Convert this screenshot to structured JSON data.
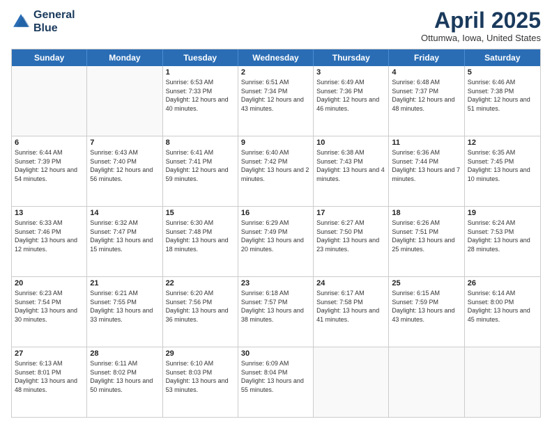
{
  "header": {
    "logo_line1": "General",
    "logo_line2": "Blue",
    "month_title": "April 2025",
    "location": "Ottumwa, Iowa, United States"
  },
  "days_of_week": [
    "Sunday",
    "Monday",
    "Tuesday",
    "Wednesday",
    "Thursday",
    "Friday",
    "Saturday"
  ],
  "weeks": [
    [
      {
        "day": "",
        "empty": true
      },
      {
        "day": "",
        "empty": true
      },
      {
        "day": "1",
        "sunrise": "6:53 AM",
        "sunset": "7:33 PM",
        "daylight": "12 hours and 40 minutes."
      },
      {
        "day": "2",
        "sunrise": "6:51 AM",
        "sunset": "7:34 PM",
        "daylight": "12 hours and 43 minutes."
      },
      {
        "day": "3",
        "sunrise": "6:49 AM",
        "sunset": "7:36 PM",
        "daylight": "12 hours and 46 minutes."
      },
      {
        "day": "4",
        "sunrise": "6:48 AM",
        "sunset": "7:37 PM",
        "daylight": "12 hours and 48 minutes."
      },
      {
        "day": "5",
        "sunrise": "6:46 AM",
        "sunset": "7:38 PM",
        "daylight": "12 hours and 51 minutes."
      }
    ],
    [
      {
        "day": "6",
        "sunrise": "6:44 AM",
        "sunset": "7:39 PM",
        "daylight": "12 hours and 54 minutes."
      },
      {
        "day": "7",
        "sunrise": "6:43 AM",
        "sunset": "7:40 PM",
        "daylight": "12 hours and 56 minutes."
      },
      {
        "day": "8",
        "sunrise": "6:41 AM",
        "sunset": "7:41 PM",
        "daylight": "12 hours and 59 minutes."
      },
      {
        "day": "9",
        "sunrise": "6:40 AM",
        "sunset": "7:42 PM",
        "daylight": "13 hours and 2 minutes."
      },
      {
        "day": "10",
        "sunrise": "6:38 AM",
        "sunset": "7:43 PM",
        "daylight": "13 hours and 4 minutes."
      },
      {
        "day": "11",
        "sunrise": "6:36 AM",
        "sunset": "7:44 PM",
        "daylight": "13 hours and 7 minutes."
      },
      {
        "day": "12",
        "sunrise": "6:35 AM",
        "sunset": "7:45 PM",
        "daylight": "13 hours and 10 minutes."
      }
    ],
    [
      {
        "day": "13",
        "sunrise": "6:33 AM",
        "sunset": "7:46 PM",
        "daylight": "13 hours and 12 minutes."
      },
      {
        "day": "14",
        "sunrise": "6:32 AM",
        "sunset": "7:47 PM",
        "daylight": "13 hours and 15 minutes."
      },
      {
        "day": "15",
        "sunrise": "6:30 AM",
        "sunset": "7:48 PM",
        "daylight": "13 hours and 18 minutes."
      },
      {
        "day": "16",
        "sunrise": "6:29 AM",
        "sunset": "7:49 PM",
        "daylight": "13 hours and 20 minutes."
      },
      {
        "day": "17",
        "sunrise": "6:27 AM",
        "sunset": "7:50 PM",
        "daylight": "13 hours and 23 minutes."
      },
      {
        "day": "18",
        "sunrise": "6:26 AM",
        "sunset": "7:51 PM",
        "daylight": "13 hours and 25 minutes."
      },
      {
        "day": "19",
        "sunrise": "6:24 AM",
        "sunset": "7:53 PM",
        "daylight": "13 hours and 28 minutes."
      }
    ],
    [
      {
        "day": "20",
        "sunrise": "6:23 AM",
        "sunset": "7:54 PM",
        "daylight": "13 hours and 30 minutes."
      },
      {
        "day": "21",
        "sunrise": "6:21 AM",
        "sunset": "7:55 PM",
        "daylight": "13 hours and 33 minutes."
      },
      {
        "day": "22",
        "sunrise": "6:20 AM",
        "sunset": "7:56 PM",
        "daylight": "13 hours and 36 minutes."
      },
      {
        "day": "23",
        "sunrise": "6:18 AM",
        "sunset": "7:57 PM",
        "daylight": "13 hours and 38 minutes."
      },
      {
        "day": "24",
        "sunrise": "6:17 AM",
        "sunset": "7:58 PM",
        "daylight": "13 hours and 41 minutes."
      },
      {
        "day": "25",
        "sunrise": "6:15 AM",
        "sunset": "7:59 PM",
        "daylight": "13 hours and 43 minutes."
      },
      {
        "day": "26",
        "sunrise": "6:14 AM",
        "sunset": "8:00 PM",
        "daylight": "13 hours and 45 minutes."
      }
    ],
    [
      {
        "day": "27",
        "sunrise": "6:13 AM",
        "sunset": "8:01 PM",
        "daylight": "13 hours and 48 minutes."
      },
      {
        "day": "28",
        "sunrise": "6:11 AM",
        "sunset": "8:02 PM",
        "daylight": "13 hours and 50 minutes."
      },
      {
        "day": "29",
        "sunrise": "6:10 AM",
        "sunset": "8:03 PM",
        "daylight": "13 hours and 53 minutes."
      },
      {
        "day": "30",
        "sunrise": "6:09 AM",
        "sunset": "8:04 PM",
        "daylight": "13 hours and 55 minutes."
      },
      {
        "day": "",
        "empty": true
      },
      {
        "day": "",
        "empty": true
      },
      {
        "day": "",
        "empty": true
      }
    ]
  ]
}
